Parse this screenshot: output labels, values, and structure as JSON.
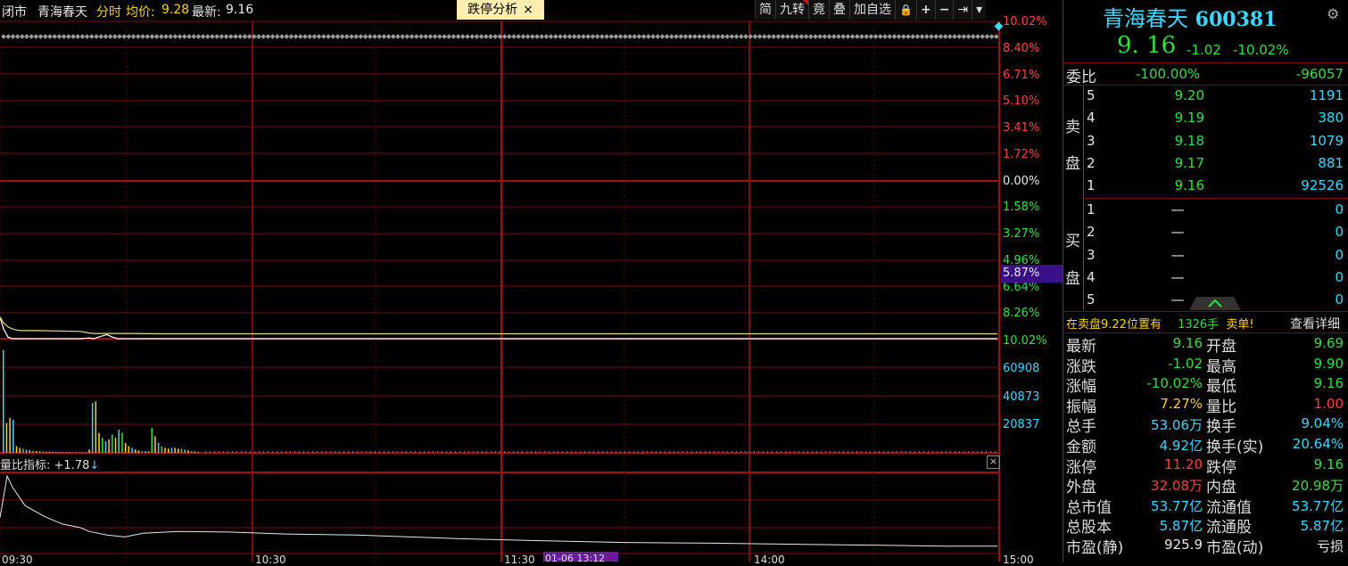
{
  "topbar": {
    "status": "闭市",
    "name": "青海春天",
    "mode": "分时",
    "avg_label": "均价:",
    "avg_value": "9.28",
    "last_label": "最新:",
    "last_value": "9.16",
    "limit_tab": "跌停分析",
    "limit_tab_close": "×"
  },
  "toolbar": [
    "简",
    "九转",
    "竟",
    "叠",
    "加自选",
    "🔒",
    "+",
    "−",
    "⇥",
    "▾"
  ],
  "price_axis": [
    "10.02%",
    "8.40%",
    "6.71%",
    "5.10%",
    "3.41%",
    "1.72%",
    "0.00%",
    "1.58%",
    "3.27%",
    "4.96%",
    "6.64%",
    "8.26%",
    "10.02%"
  ],
  "price_axis_colors": [
    "#ff4040",
    "#ff4040",
    "#ff4040",
    "#ff4040",
    "#ff4040",
    "#ff4040",
    "#e8e8e8",
    "#30e040",
    "#30e040",
    "#30e040",
    "#30e040",
    "#30e040",
    "#30e040"
  ],
  "cursor_label": "5.87%",
  "volume_axis": [
    "60908",
    "40873",
    "20837"
  ],
  "volume_ratio": {
    "label": "量比指标:",
    "value": "+1.78",
    "arrow": "↓",
    "close": "×"
  },
  "time_axis": [
    "09:30",
    "10:30",
    "11:30",
    "14:00",
    "15:00"
  ],
  "cursor_time": "01-06 13:12",
  "panel": {
    "name": "青海春天",
    "code": "600381",
    "price": "9. 16",
    "change": "-1.02",
    "change_pct": "-10.02%",
    "weibi_label": "委比",
    "weibi_pct": "-100.00%",
    "weibi_diff": "-96057",
    "sell_label": [
      "卖",
      "盘"
    ],
    "buy_label": [
      "买",
      "盘"
    ],
    "sell": [
      {
        "level": "5",
        "price": "9.20",
        "vol": "1191"
      },
      {
        "level": "4",
        "price": "9.19",
        "vol": "380"
      },
      {
        "level": "3",
        "price": "9.18",
        "vol": "1079"
      },
      {
        "level": "2",
        "price": "9.17",
        "vol": "881"
      },
      {
        "level": "1",
        "price": "9.16",
        "vol": "92526"
      }
    ],
    "buy": [
      {
        "level": "1",
        "price": "—",
        "vol": "0"
      },
      {
        "level": "2",
        "price": "—",
        "vol": "0"
      },
      {
        "level": "3",
        "price": "—",
        "vol": "0"
      },
      {
        "level": "4",
        "price": "—",
        "vol": "0"
      },
      {
        "level": "5",
        "price": "—",
        "vol": "0"
      }
    ],
    "notice_a": "在卖盘9.22位置有",
    "notice_num": "1326手",
    "notice_b": "卖单!",
    "notice_link": "查看详细",
    "stats": [
      {
        "l1": "最新",
        "v1": "9.16",
        "c1": "#30e040",
        "l2": "开盘",
        "v2": "9.69",
        "c2": "#30e040"
      },
      {
        "l1": "涨跌",
        "v1": "-1.02",
        "c1": "#30e040",
        "l2": "最高",
        "v2": "9.90",
        "c2": "#30e040"
      },
      {
        "l1": "涨幅",
        "v1": "-10.02%",
        "c1": "#30e040",
        "l2": "最低",
        "v2": "9.16",
        "c2": "#30e040"
      },
      {
        "l1": "振幅",
        "v1": "7.27%",
        "c1": "#ffcc33",
        "l2": "量比",
        "v2": "1.00",
        "c2": "#ff4040"
      },
      {
        "l1": "总手",
        "v1": "53.06万",
        "c1": "#3cd6ff",
        "l2": "换手",
        "v2": "9.04%",
        "c2": "#3cd6ff"
      },
      {
        "l1": "金额",
        "v1": "4.92亿",
        "c1": "#3cd6ff",
        "l2": "换手(实)",
        "v2": "20.64%",
        "c2": "#3cd6ff"
      },
      {
        "l1": "涨停",
        "v1": "11.20",
        "c1": "#ff4040",
        "l2": "跌停",
        "v2": "9.16",
        "c2": "#30e040"
      },
      {
        "l1": "外盘",
        "v1": "32.08万",
        "c1": "#ff4040",
        "l2": "内盘",
        "v2": "20.98万",
        "c2": "#30e040"
      },
      {
        "l1": "总市值",
        "v1": "53.77亿",
        "c1": "#3cd6ff",
        "l2": "流通值",
        "v2": "53.77亿",
        "c2": "#3cd6ff"
      },
      {
        "l1": "总股本",
        "v1": "5.87亿",
        "c1": "#3cd6ff",
        "l2": "流通股",
        "v2": "5.87亿",
        "c2": "#3cd6ff"
      },
      {
        "l1": "市盈(静)",
        "v1": "925.9",
        "c1": "#e8e8e8",
        "l2": "市盈(动)",
        "v2": "亏损",
        "c2": "#e8e8e8"
      }
    ]
  },
  "chart_data": {
    "type": "line",
    "x": [
      "09:30",
      "09:31",
      "09:32",
      "09:33",
      "09:35",
      "09:40",
      "09:50",
      "10:00",
      "10:05",
      "10:08",
      "10:10",
      "10:12",
      "10:14",
      "10:16",
      "10:18",
      "10:20",
      "10:25",
      "10:30",
      "11:30",
      "13:00",
      "14:00",
      "15:00"
    ],
    "series": [
      {
        "values": [
          9.69,
          9.4,
          9.2,
          9.16,
          9.16,
          9.16,
          9.16,
          9.16,
          9.18,
          9.16,
          9.21,
          9.26,
          9.2,
          9.16,
          9.16,
          9.16,
          9.16,
          9.16,
          9.16,
          9.16,
          9.16,
          9.16
        ]
      },
      {
        "values": [
          9.69,
          9.55,
          9.45,
          9.4,
          9.36,
          9.36,
          9.35,
          9.34,
          9.3,
          9.29,
          9.29,
          9.29,
          9.29,
          9.29,
          9.29,
          9.29,
          9.28,
          9.28,
          9.28,
          9.28,
          9.28,
          9.28
        ]
      }
    ],
    "ylim": [
      9.16,
      11.2
    ],
    "volume_ylim": [
      0,
      80000
    ],
    "volume_sample": [
      62000,
      18000,
      21000,
      20000,
      4000,
      3000,
      2500,
      2000,
      1500,
      1200,
      1000,
      900,
      800,
      700,
      700,
      600,
      500,
      500,
      400,
      400,
      400,
      300,
      300,
      300,
      300,
      300,
      2000,
      30000,
      31000,
      12000,
      9000,
      7000,
      8000,
      11000,
      9000,
      14000,
      12000,
      6000,
      4000,
      3000,
      2000,
      1500,
      1000,
      1000,
      900,
      15000,
      10000,
      6000,
      4000,
      3000,
      2500,
      3000,
      3000,
      2500,
      2500,
      2000,
      1500,
      1000,
      800,
      600
    ],
    "volume_ratio_values": [
      1.78,
      2.9,
      2.6,
      2.1,
      1.8,
      1.6,
      1.5,
      1.4,
      1.3,
      1.25,
      1.35,
      1.4,
      1.38,
      1.33,
      1.3,
      1.25,
      1.2,
      1.15,
      1.1,
      1.08,
      1.05,
      1.02,
      1.0,
      1.0
    ]
  }
}
